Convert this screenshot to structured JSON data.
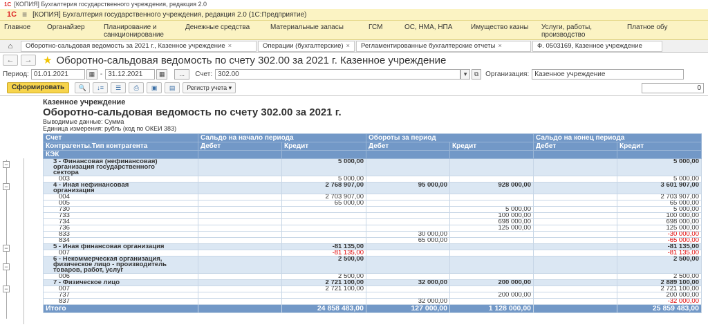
{
  "window_title": "[КОПИЯ] Бухгалтерия государственного учреждения, редакция 2.0",
  "app": {
    "logo": "1С",
    "title": "[КОПИЯ] Бухгалтерия государственного учреждения, редакция 2.0  (1С:Предприятие)"
  },
  "sections": [
    "Главное",
    "Органайзер",
    "Планирование и\nсанкционирование",
    "Денежные средства",
    "Материальные запасы",
    "ГСМ",
    "ОС, НМА, НПА",
    "Имущество казны",
    "Услуги, работы,\nпроизводство",
    "Платное обу"
  ],
  "tabs": [
    "Оборотно-сальдовая ведомость за 2021 г., Казенное учреждение",
    "Операции (бухгалтерские)",
    "Регламентированные бухгалтерские отчеты",
    "Ф. 0503169, Казенное учреждение"
  ],
  "doc_title": "Оборотно-сальдовая ведомость по счету 302.00 за 2021 г. Казенное учреждение",
  "filters": {
    "period_label": "Период:",
    "date_from": "01.01.2021",
    "dash": "-",
    "date_to": "31.12.2021",
    "ellipsis": "...",
    "account_label": "Счет:",
    "account": "302.00",
    "org_label": "Организация:",
    "org": "Казенное учреждение"
  },
  "toolbar": {
    "generate": "Сформировать",
    "register": "Регистр учета",
    "right_value": "0"
  },
  "report": {
    "org": "Казенное учреждение",
    "title": "Оборотно-сальдовая ведомость по счету 302.00 за 2021 г.",
    "output_line": "Выводимые данные:   Сумма",
    "unit_line": "Единица измерения: рубль (код по ОКЕИ 383)",
    "headers": {
      "row1": [
        "Счет",
        "Сальдо на начало периода",
        "Обороты за период",
        "Сальдо на конец периода"
      ],
      "row2": [
        "Контрагенты.Тип контрагента",
        "Дебет",
        "Кредит",
        "Дебет",
        "Кредит",
        "Дебет",
        "Кредит"
      ],
      "row3": [
        "КЭК"
      ]
    },
    "rows": [
      {
        "type": "grp",
        "cells": [
          "3 - Финансовая (нефинансовая)\nорганизация государственного\nсектора",
          "",
          "5 000,00",
          "",
          "",
          "",
          "5 000,00"
        ]
      },
      {
        "type": "row",
        "cells": [
          "003",
          "",
          "5 000,00",
          "",
          "",
          "",
          "5 000,00"
        ]
      },
      {
        "type": "grp",
        "cells": [
          "4 - Иная нефинансовая\nорганизация",
          "",
          "2 768 907,00",
          "95 000,00",
          "928 000,00",
          "",
          "3 601 907,00"
        ]
      },
      {
        "type": "row",
        "cells": [
          "004",
          "",
          "2 703 907,00",
          "",
          "",
          "",
          "2 703 907,00"
        ]
      },
      {
        "type": "row",
        "cells": [
          "005",
          "",
          "65 000,00",
          "",
          "",
          "",
          "65 000,00"
        ]
      },
      {
        "type": "row",
        "cells": [
          "730",
          "",
          "",
          "",
          "5 000,00",
          "",
          "5 000,00"
        ]
      },
      {
        "type": "row",
        "cells": [
          "733",
          "",
          "",
          "",
          "100 000,00",
          "",
          "100 000,00"
        ]
      },
      {
        "type": "row",
        "cells": [
          "734",
          "",
          "",
          "",
          "698 000,00",
          "",
          "698 000,00"
        ]
      },
      {
        "type": "row",
        "cells": [
          "736",
          "",
          "",
          "",
          "125 000,00",
          "",
          "125 000,00"
        ]
      },
      {
        "type": "row",
        "cells": [
          "833",
          "",
          "",
          "30 000,00",
          "",
          "",
          "-30 000,00"
        ]
      },
      {
        "type": "row",
        "cells": [
          "834",
          "",
          "",
          "65 000,00",
          "",
          "",
          "-65 000,00"
        ]
      },
      {
        "type": "grp",
        "cells": [
          "5 - Иная финансовая организация",
          "",
          "-81 135,00",
          "",
          "",
          "",
          "-81 135,00"
        ]
      },
      {
        "type": "row",
        "cells": [
          "007",
          "",
          "-81 135,00",
          "",
          "",
          "",
          "-81 135,00"
        ]
      },
      {
        "type": "grp",
        "cells": [
          "6 - Некоммерческая организация,\nфизическое лицо - производитель\nтоваров, работ, услуг",
          "",
          "2 500,00",
          "",
          "",
          "",
          "2 500,00"
        ]
      },
      {
        "type": "row",
        "cells": [
          "006",
          "",
          "2 500,00",
          "",
          "",
          "",
          "2 500,00"
        ]
      },
      {
        "type": "grp",
        "cells": [
          "7 - Физическое лицо",
          "",
          "2 721 100,00",
          "32 000,00",
          "200 000,00",
          "",
          "2 889 100,00"
        ]
      },
      {
        "type": "row",
        "cells": [
          "007",
          "",
          "2 721 100,00",
          "",
          "",
          "",
          "2 721 100,00"
        ]
      },
      {
        "type": "row",
        "cells": [
          "737",
          "",
          "",
          "",
          "200 000,00",
          "",
          "200 000,00"
        ]
      },
      {
        "type": "row",
        "cells": [
          "837",
          "",
          "",
          "32 000,00",
          "",
          "",
          "-32 000,00"
        ]
      }
    ],
    "total": [
      "Итого",
      "",
      "24 858 483,00",
      "127 000,00",
      "1 128 000,00",
      "",
      "25 859 483,00"
    ]
  }
}
